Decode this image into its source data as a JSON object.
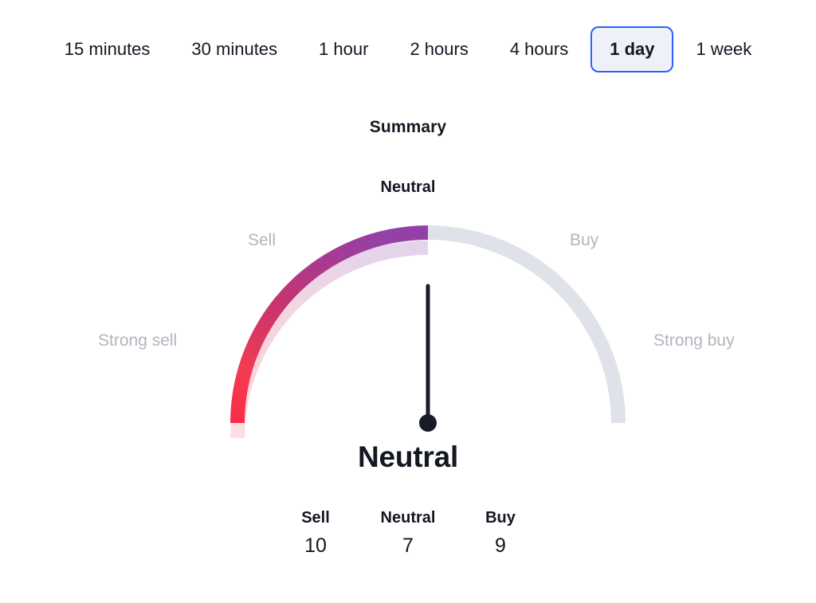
{
  "timeframe_tabs": [
    {
      "label": "15 minutes",
      "selected": false
    },
    {
      "label": "30 minutes",
      "selected": false
    },
    {
      "label": "1 hour",
      "selected": false
    },
    {
      "label": "2 hours",
      "selected": false
    },
    {
      "label": "4 hours",
      "selected": false
    },
    {
      "label": "1 day",
      "selected": true
    },
    {
      "label": "1 week",
      "selected": false
    }
  ],
  "summary": {
    "title": "Summary",
    "status_top": "Neutral",
    "verdict": "Neutral"
  },
  "gauge": {
    "ring_labels": {
      "strong_sell": "Strong sell",
      "sell": "Sell",
      "buy": "Buy",
      "strong_buy": "Strong buy"
    },
    "needle_position": "Neutral",
    "needle_angle_deg": 0
  },
  "counts": [
    {
      "label": "Sell",
      "value": "10"
    },
    {
      "label": "Neutral",
      "value": "7"
    },
    {
      "label": "Buy",
      "value": "9"
    }
  ],
  "colors": {
    "accent_selected_border": "#2962FF",
    "accent_selected_bg": "#EEF2F8",
    "text_primary": "#131722",
    "text_muted": "#B2B5BE",
    "arc_sell_start": "#F7344E",
    "arc_sell_end": "#9341A8",
    "arc_sell_pale_start": "#FBD2D8",
    "arc_sell_pale_end": "#E6D5EA",
    "arc_neutral_gray": "#DFE2E9",
    "needle": "#191B26"
  },
  "chart_data": {
    "type": "gauge",
    "title": "Summary",
    "value_label": "Neutral",
    "segments": [
      {
        "name": "Strong sell",
        "color": "#F7344E"
      },
      {
        "name": "Sell",
        "color": "#9341A8"
      },
      {
        "name": "Neutral",
        "color": "#DFE2E9"
      },
      {
        "name": "Buy",
        "color": "#DFE2E9"
      },
      {
        "name": "Strong buy",
        "color": "#DFE2E9"
      }
    ],
    "needle_angle_deg": 0,
    "counts": {
      "Sell": 10,
      "Neutral": 7,
      "Buy": 9
    },
    "categories": [
      "Sell",
      "Neutral",
      "Buy"
    ],
    "values": [
      10,
      7,
      9
    ],
    "xlabel": "",
    "ylabel": "",
    "legend": [
      "Strong sell",
      "Sell",
      "Buy",
      "Strong buy"
    ]
  }
}
